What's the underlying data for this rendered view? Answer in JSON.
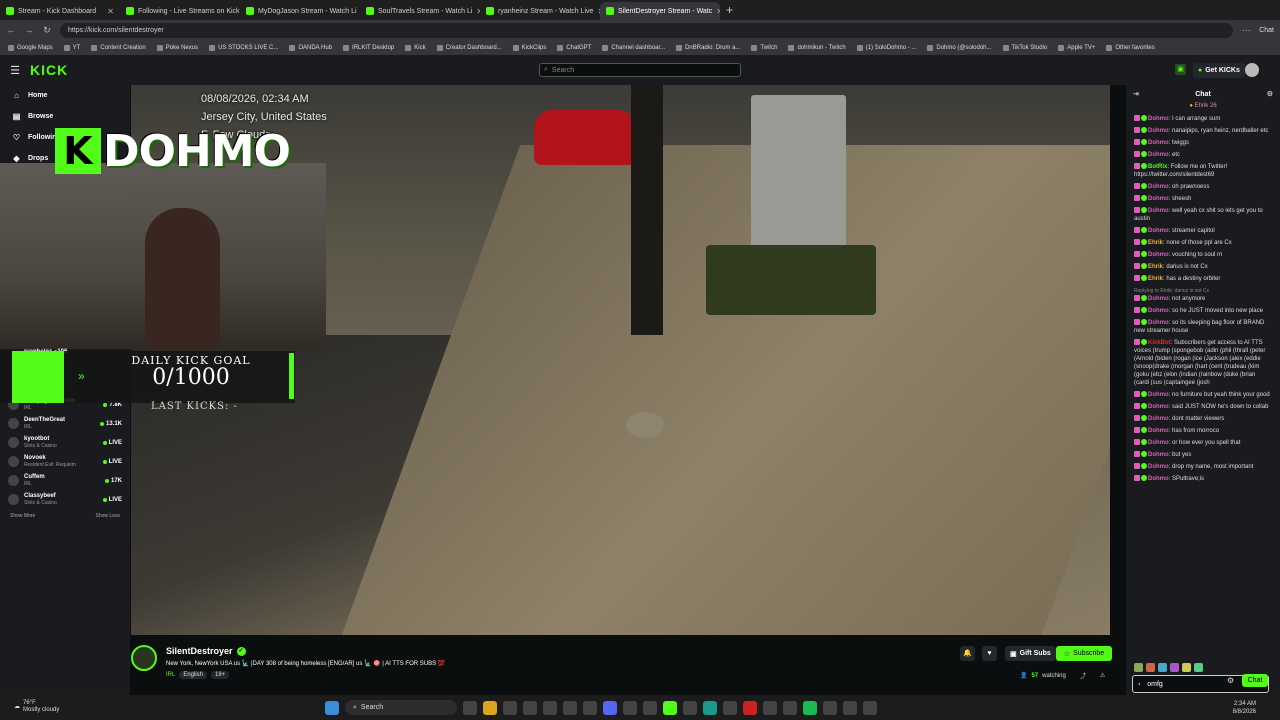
{
  "browser": {
    "tabs": [
      {
        "label": "Stream - Kick Dashboard",
        "active": false
      },
      {
        "label": "Following - Live Streams on Kick",
        "active": false
      },
      {
        "label": "MyDogJason Stream - Watch Li",
        "active": false
      },
      {
        "label": "SoulTravels Stream - Watch Li",
        "active": false
      },
      {
        "label": "ryanheinz Stream - Watch Live",
        "active": false
      },
      {
        "label": "SilentDestroyer Stream - Watc",
        "active": true
      }
    ],
    "url": "https://kick.com/silentdestroyer",
    "bookmarks": [
      "Google Maps",
      "YT",
      "Content Creation",
      "Poke Nexus",
      "US STOCKS LIVE C...",
      "OANDA Hub",
      "IRLKIT Desktop",
      "Kick",
      "Creator Dashboard...",
      "KickClips",
      "ChatGPT",
      "Channel dashboar...",
      "DnBRadio: Drum a...",
      "Twitch",
      "dohmikun - Twitch",
      "(1) SoloDohmo - ...",
      "Dohmo (@solodoh...",
      "TikTok Studio",
      "Apple TV+",
      "Other favorites"
    ],
    "chat_button": "Chat"
  },
  "kick": {
    "logo": "KICK",
    "search_placeholder": "Search",
    "get_kicks": "Get KICKs",
    "nav": [
      "Home",
      "Browse",
      "Following",
      "Drops"
    ],
    "channels": [
      {
        "name": "RampageJackson",
        "sub": "IRL",
        "count": "7.8K"
      },
      {
        "name": "DeenTheGreat",
        "sub": "IRL",
        "count": "13.1K"
      },
      {
        "name": "kyootbot",
        "sub": "Slots & Casino",
        "count": "LIVE"
      },
      {
        "name": "Novoek",
        "sub": "Resident Evil: Requiem",
        "count": "LIVE"
      },
      {
        "name": "Cuffem",
        "sub": "IRL",
        "count": "17K"
      },
      {
        "name": "Classybeef",
        "sub": "Slots & Casino",
        "count": "LIVE"
      }
    ],
    "show_more": "Show More",
    "show_less": "Show Less"
  },
  "video": {
    "osd_date": "08/08/2026, 02:34 AM",
    "osd_location": "Jersey City, United States",
    "osd_weather": "F, Few Clouds",
    "overlay_brand": "DOHMO",
    "goal_title": "DAILY KICK GOAL",
    "goal_value": "0/1000",
    "goal_fraction": 0,
    "last_kicks": "LAST KICKS: -",
    "overlay_viewer": "ryanheinz",
    "overlay_viewer_count": "106"
  },
  "streamer": {
    "name": "SilentDestroyer",
    "title": "New York, NewYork USA us 🗽 |DAY 308 of being homeless [ENG/AR] us 🗽 🎯 | AI TTS FOR SUBS 💯",
    "category": "IRL",
    "tags": [
      "English",
      "18+"
    ],
    "gift_subs": "Gift Subs",
    "subscribe": "Subscribe",
    "watching_count": "57",
    "watching_label": "watching"
  },
  "chat": {
    "title": "Chat",
    "pinned": "Ehrik 26",
    "messages": [
      {
        "user": "Dohmo",
        "color": "#e15cbd",
        "text": "I can arrange sum"
      },
      {
        "user": "Dohmo",
        "color": "#e15cbd",
        "text": "nanaipips, ryan heinz, nerdballer etc"
      },
      {
        "user": "Dohmo",
        "color": "#e15cbd",
        "text": "twiggs"
      },
      {
        "user": "Dohmo",
        "color": "#e15cbd",
        "text": "etc"
      },
      {
        "user": "BotRix",
        "color": "#53fc18",
        "text": "Follow me on Twitter! https://twitter.com/silentdest69"
      },
      {
        "user": "Dohmo",
        "color": "#e15cbd",
        "text": "oh prawnoess"
      },
      {
        "user": "Dohmo",
        "color": "#e15cbd",
        "text": "sheesh"
      },
      {
        "user": "Dohmo",
        "color": "#e15cbd",
        "text": "well yeah cx shit so lets get you to austin"
      },
      {
        "user": "Dohmo",
        "color": "#e15cbd",
        "text": "streamer capitol"
      },
      {
        "user": "Ehrik",
        "color": "#f0b429",
        "text": "none of those ppl are Cx"
      },
      {
        "user": "Dohmo",
        "color": "#e15cbd",
        "text": "vouching to soul rn"
      },
      {
        "user": "Ehrik",
        "color": "#f0b429",
        "text": "darius is not Cx"
      },
      {
        "user": "Ehrik",
        "color": "#f0b429",
        "text": "has a destiny orbiter"
      },
      {
        "user": "Dohmo",
        "color": "#e15cbd",
        "text": "not anymore",
        "reply": "Replying to Ehrik: darius is not Cx"
      },
      {
        "user": "Dohmo",
        "color": "#e15cbd",
        "text": "so he JUST moved into new place"
      },
      {
        "user": "Dohmo",
        "color": "#e15cbd",
        "text": "so its sleeping bag floor of BRAND new streamer house"
      },
      {
        "user": "KickBot",
        "color": "#e02a2a",
        "text": "Subscribers get access to AI TTS voices (trump (spongebob (adin (phil (thrall (peter (Arnold (biden (rogan (ice (Jackson (alex (eddie (snoop(drake (morgan (hart (cent (trudeau (kim (goku (ebz (elon (indian (rainbow (duke (brian (cardi (sus (captaingee (josh"
      },
      {
        "user": "Dohmo",
        "color": "#e15cbd",
        "text": "no furniture but yeah think your good"
      },
      {
        "user": "Dohmo",
        "color": "#e15cbd",
        "text": "said JUST NOW he's down to collab"
      },
      {
        "user": "Dohmo",
        "color": "#e15cbd",
        "text": "dont matter viewers"
      },
      {
        "user": "Dohmo",
        "color": "#e15cbd",
        "text": "has from morroco"
      },
      {
        "user": "Dohmo",
        "color": "#e15cbd",
        "text": "or how ever you spell that"
      },
      {
        "user": "Dohmo",
        "color": "#e15cbd",
        "text": "but yes"
      },
      {
        "user": "Dohmo",
        "color": "#e15cbd",
        "text": "drop my name, most important"
      },
      {
        "user": "Dohmo",
        "color": "#e15cbd",
        "text": "SPultrave;is"
      }
    ],
    "input_value": "omfg",
    "kick_count": "20",
    "points": "0",
    "send_label": "Chat"
  },
  "taskbar": {
    "temp": "76°F",
    "weather": "Mostly cloudy",
    "search": "Search",
    "time": "2:34 AM",
    "date": "8/8/2026"
  },
  "colors": {
    "accent": "#53fc18",
    "bg": "#0b0e0f",
    "panel": "#191b1f"
  }
}
